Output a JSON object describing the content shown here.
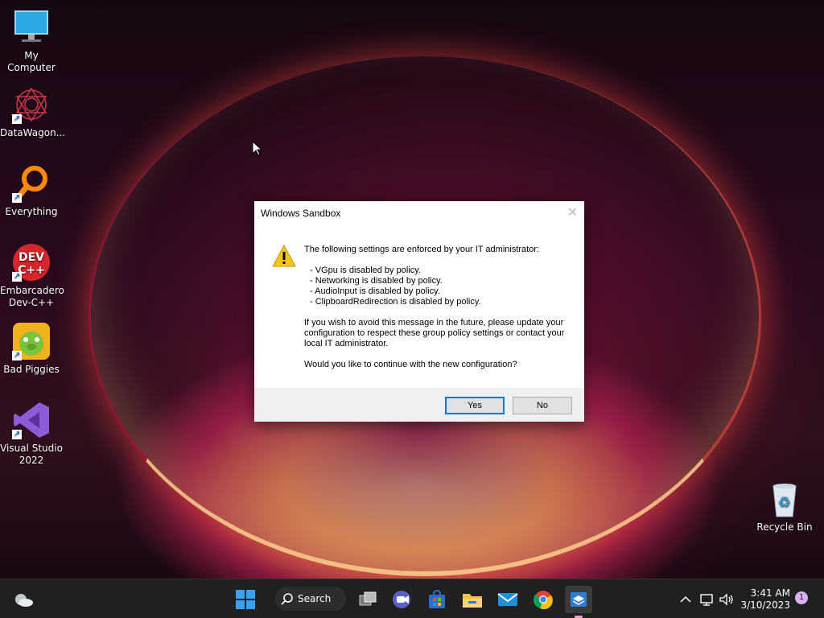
{
  "desktop": {
    "icons": [
      {
        "label": "My Computer",
        "icon": "monitor-icon"
      },
      {
        "label": "DataWagon...",
        "icon": "datawagon-icon"
      },
      {
        "label": "Everything",
        "icon": "search-magnifier-icon"
      },
      {
        "label": "Embarcadero Dev-C++",
        "icon": "devcpp-icon"
      },
      {
        "label": "Bad Piggies",
        "icon": "bad-piggies-icon"
      },
      {
        "label": "Visual Studio 2022",
        "icon": "visual-studio-icon"
      },
      {
        "label": "Recycle Bin",
        "icon": "recycle-bin-icon"
      }
    ]
  },
  "dialog": {
    "title": "Windows Sandbox",
    "close": "✕",
    "heading": "The following settings are enforced by your IT administrator:",
    "policies": [
      "- VGpu is disabled by policy.",
      "- Networking is disabled by policy.",
      "- AudioInput is disabled by policy.",
      "- ClipboardRedirection is disabled by policy."
    ],
    "paragraph": "If you wish to avoid this message in the future, please update your configuration to respect these group policy settings or contact your local IT administrator.",
    "question": "Would you like to continue with the new configuration?",
    "yes": "Yes",
    "no": "No"
  },
  "taskbar": {
    "search": "Search",
    "time": "3:41 AM",
    "date": "3/10/2023",
    "notification_count": "1"
  }
}
